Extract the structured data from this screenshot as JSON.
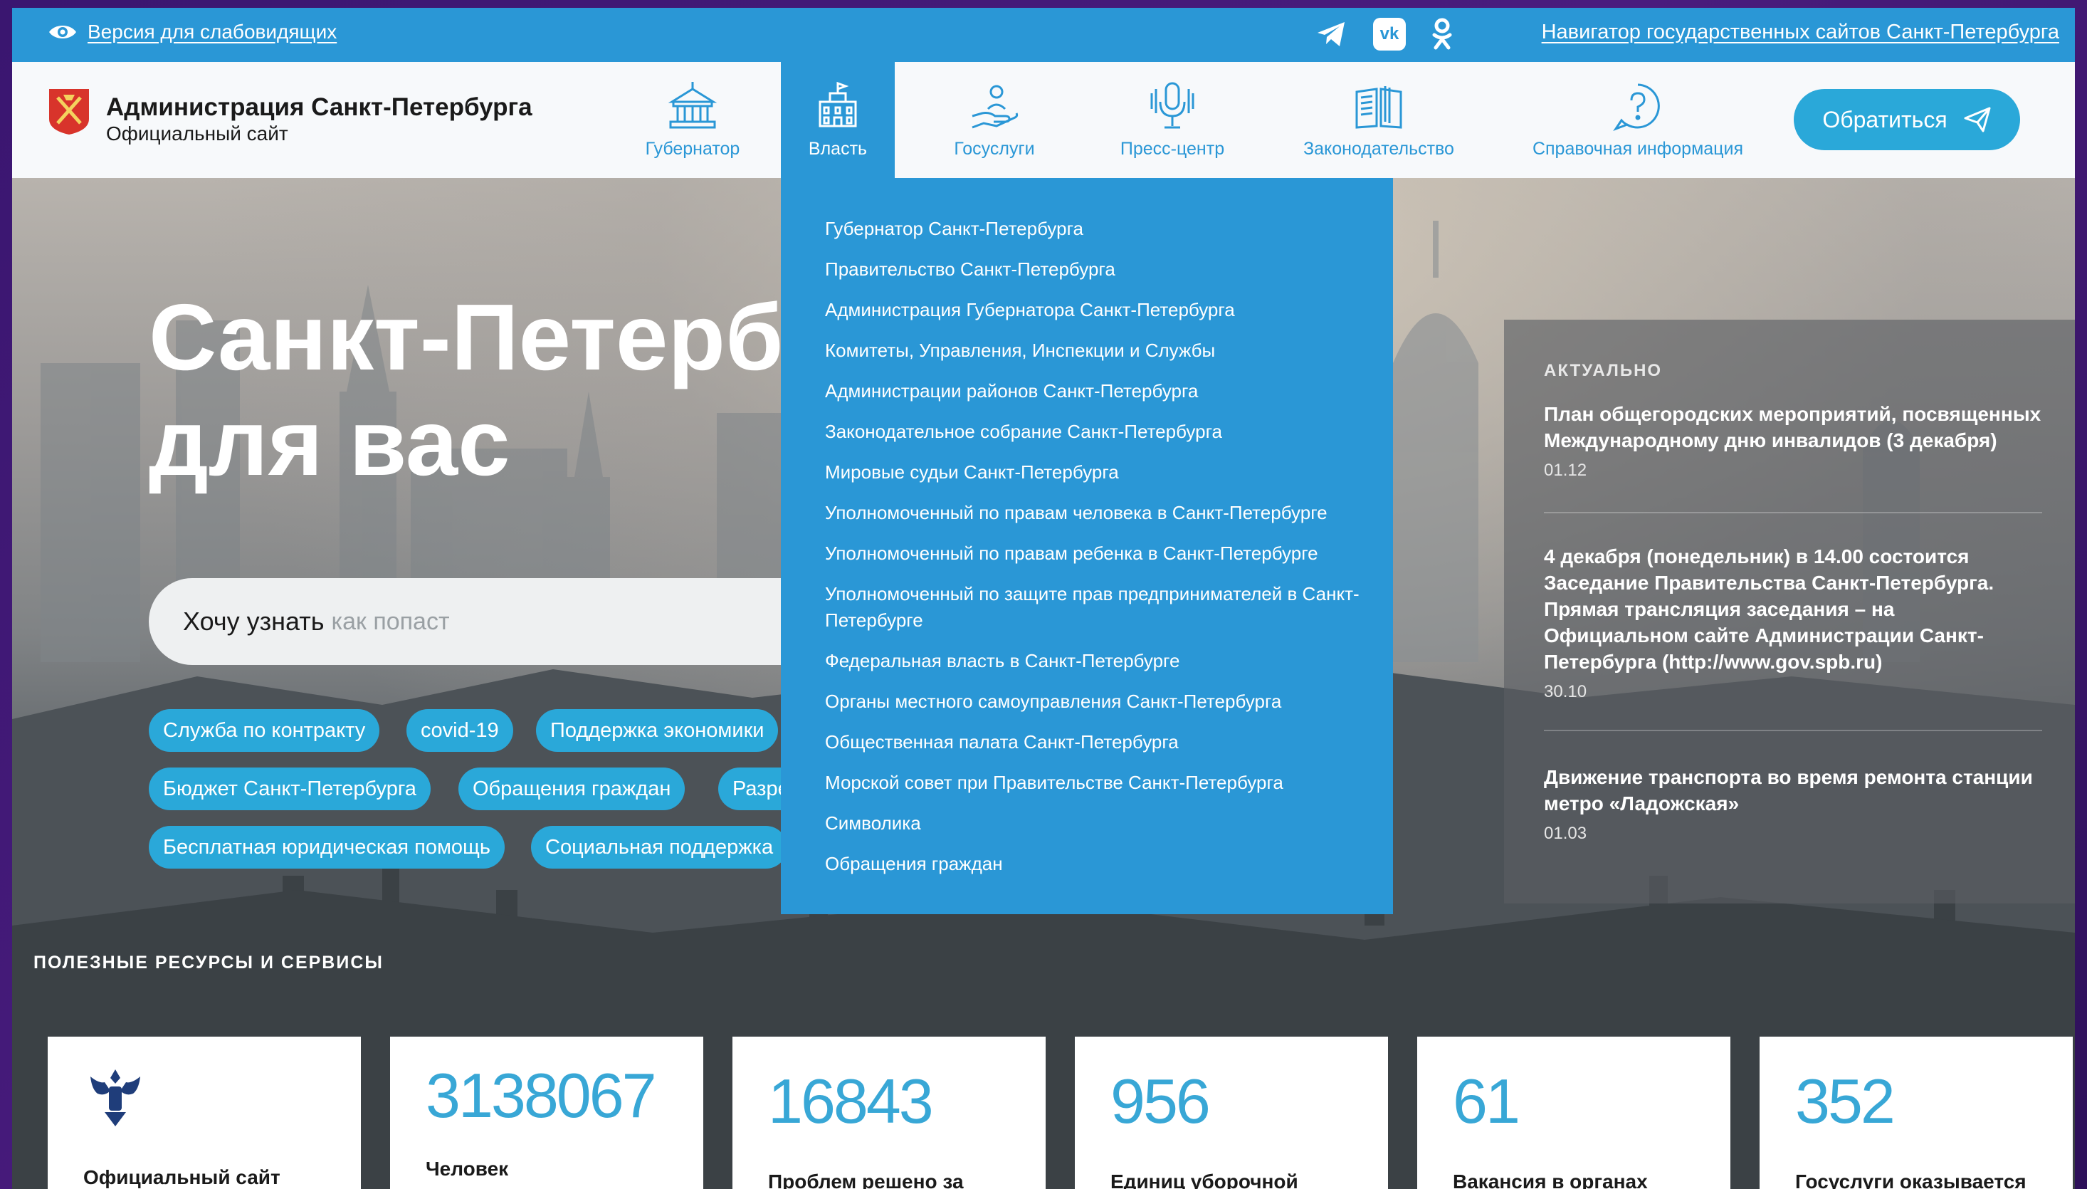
{
  "topbar": {
    "accessibility_label": "Версия для слабовидящих",
    "social": [
      "telegram-icon",
      "vk-icon",
      "odnoklassniki-icon"
    ],
    "navigator_link": "Навигатор государственных сайтов Санкт-Петербурга"
  },
  "header": {
    "title": "Администрация Санкт-Петербурга",
    "subtitle": "Официальный сайт",
    "menu": [
      {
        "label": "Губернатор",
        "icon": "government-building-icon"
      },
      {
        "label": "Власть",
        "icon": "city-hall-icon"
      },
      {
        "label": "Госуслуги",
        "icon": "hand-service-icon"
      },
      {
        "label": "Пресс-центр",
        "icon": "microphone-icon"
      },
      {
        "label": "Законодательство",
        "icon": "book-icon"
      },
      {
        "label": "Справочная информация",
        "icon": "question-icon"
      }
    ],
    "cta_label": "Обратиться"
  },
  "hero": {
    "title": "Санкт-Петерб\nдля вас",
    "search_lead": "Хочу узнать",
    "search_placeholder": "как попаст",
    "tags": [
      "Служба по контракту",
      "covid-19",
      "Поддержка экономики",
      "Бюджет Санкт-Петербурга",
      "Обращения граждан",
      "Разре",
      "Бесплатная юридическая помощь",
      "Социальная поддержка"
    ]
  },
  "dropdown": {
    "items": [
      "Губернатор Санкт-Петербурга",
      "Правительство Санкт-Петербурга",
      "Администрация Губернатора Санкт-Петербурга",
      "Комитеты, Управления, Инспекции и Службы",
      "Администрации районов Санкт-Петербурга",
      "Законодательное собрание Санкт-Петербурга",
      "Мировые судьи Санкт-Петербурга",
      "Уполномоченный по правам человека в Санкт-Петербурге",
      "Уполномоченный по правам ребенка в Санкт-Петербурге",
      "Уполномоченный по защите прав предпринимателей в Санкт-Петербурге",
      "Федеральная власть в Санкт-Петербурге",
      "Органы местного самоуправления Санкт-Петербурга",
      "Общественная палата Санкт-Петербурга",
      "Морской совет при Правительстве Санкт-Петербурга",
      "Символика",
      "Обращения граждан"
    ]
  },
  "news": {
    "heading": "АКТУАЛЬНО",
    "items": [
      {
        "title": "План общегородских мероприятий, посвященных Международному дню инвалидов (3 декабря)",
        "date": "01.12"
      },
      {
        "title": "4 декабря (понедельник) в 14.00 состоится Заседание Правительства Санкт-Петербурга. Прямая трансляция заседания – на Официальном сайте Администрации Санкт-Петербурга (http://www.gov.spb.ru)",
        "date": "30.10"
      },
      {
        "title": "Движение транспорта во время ремонта станции метро «Ладожская»",
        "date": "01.03"
      }
    ]
  },
  "resources": {
    "heading": "ПОЛЕЗНЫЕ РЕСУРСЫ И СЕРВИСЫ",
    "cards": [
      {
        "number": "",
        "caption": "Официальный сайт",
        "icon": "coat-of-arms-icon"
      },
      {
        "number": "3138067",
        "caption": "Человек"
      },
      {
        "number": "16843",
        "caption": "Проблем решено за"
      },
      {
        "number": "956",
        "caption": "Единиц уборочной"
      },
      {
        "number": "61",
        "caption": "Вакансия в органах"
      },
      {
        "number": "352",
        "caption": "Госуслуги оказывается"
      }
    ]
  },
  "colors": {
    "accent": "#2a97d6",
    "cta": "#2aa8d9",
    "number": "#38a7d6"
  }
}
